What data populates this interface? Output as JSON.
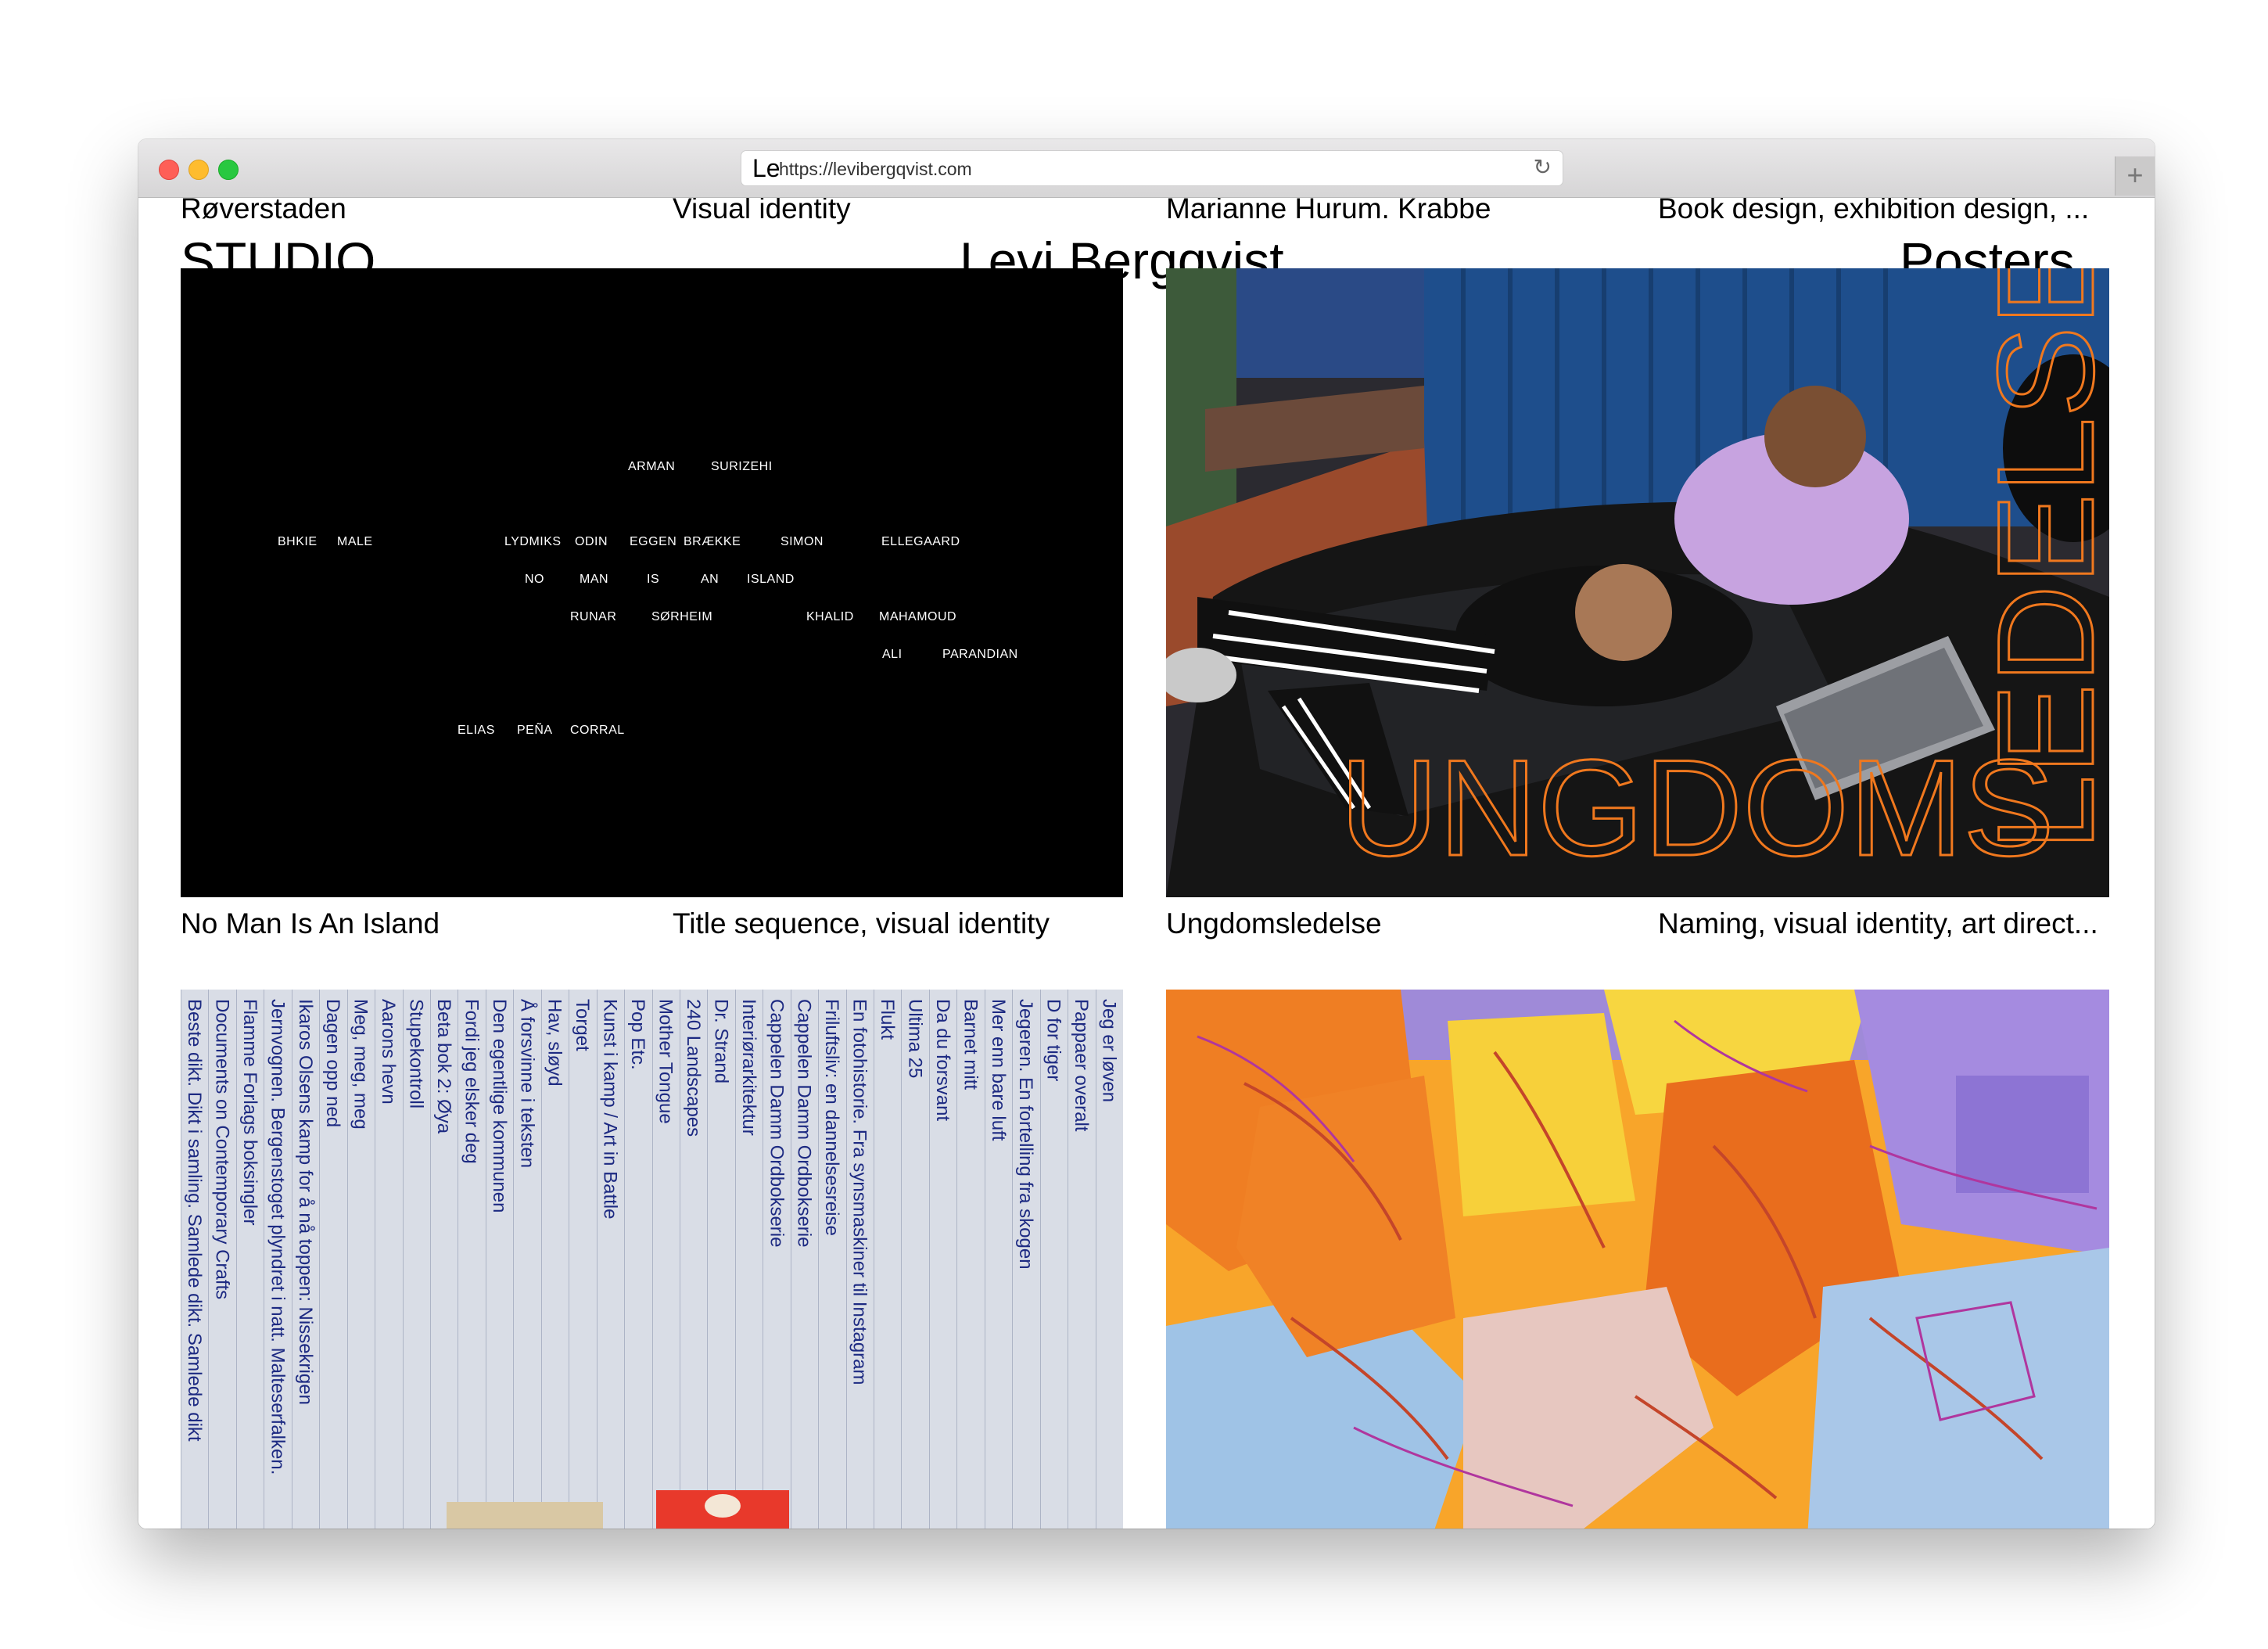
{
  "browser": {
    "favicon": "Le",
    "url": "https://levibergqvist.com",
    "reload_icon": "reload-icon",
    "newtab_label": "+"
  },
  "top_captions": {
    "left_title": "Røverstaden",
    "left_type": "Visual identity",
    "right_title": "Marianne Hurum. Krabbe",
    "right_type": "Book design, exhibition design, ..."
  },
  "header": {
    "studio": "STUDIO",
    "name": "Levi Bergqvist",
    "section": "Posters"
  },
  "projects": [
    {
      "title": "No Man Is An Island",
      "type": "Title sequence, visual identity",
      "credits": [
        "ARMAN",
        "SURIZEHI",
        "BHKIE",
        "MALE",
        "LYDMIKS",
        "ODIN",
        "EGGEN",
        "BRÆKKE",
        "SIMON",
        "ELLEGAARD",
        "NO",
        "MAN",
        "IS",
        "AN",
        "ISLAND",
        "RUNAR",
        "SØRHEIM",
        "KHALID",
        "MAHAMOUD",
        "ALI",
        "PARANDIAN",
        "ELIAS",
        "PEÑA",
        "CORRAL"
      ]
    },
    {
      "title": "Ungdomsledelse",
      "type": "Naming, visual identity, art direct...",
      "overlay_word_1": "UNGDOMS",
      "overlay_word_2": "LEDELSE"
    },
    {
      "spines": [
        "Beste dikt. Dikt i samling. Samlede dikt. Samlede dikt",
        "Documents on Contemporary Crafts",
        "Flamme Forlags boksingler",
        "Jernvognen. Bergenstoget plyndret i natt. Malteserfalken.",
        "Ikaros Olsens kamp for å nå toppen: Nissekrigen",
        "Dagen opp ned",
        "Meg, meg, meg",
        "Aarons hevn",
        "Stupekontroll",
        "Beta bok 2: Øya",
        "Fordi jeg elsker deg",
        "Den egentlige kommunen",
        "Å forsvinne i teksten",
        "Hav, sløyd",
        "Torget",
        "Kunst i kamp / Art in Battle",
        "Pop Etc.",
        "Mother Tongue",
        "240 Landscapes",
        "Dr. Strand",
        "Interiørarkitektur",
        "Cappelen Damm Ordbokserie",
        "Cappelen Damm Ordbokserie",
        "Friluftsliv: en dannelsesreise",
        "En fotohistorie. Fra synsmaskiner til Instagram",
        "Flukt",
        "Ultima 25",
        "Da du forsvant",
        "Barnet mitt",
        "Mer enn bare luft",
        "Jegeren. En fortelling fra skogen",
        "D for tiger",
        "Pappaer overalt",
        "Jeg er løven"
      ]
    },
    {}
  ],
  "colors": {
    "accent_orange": "#f0781e",
    "spine_ink": "#1d2a82"
  }
}
